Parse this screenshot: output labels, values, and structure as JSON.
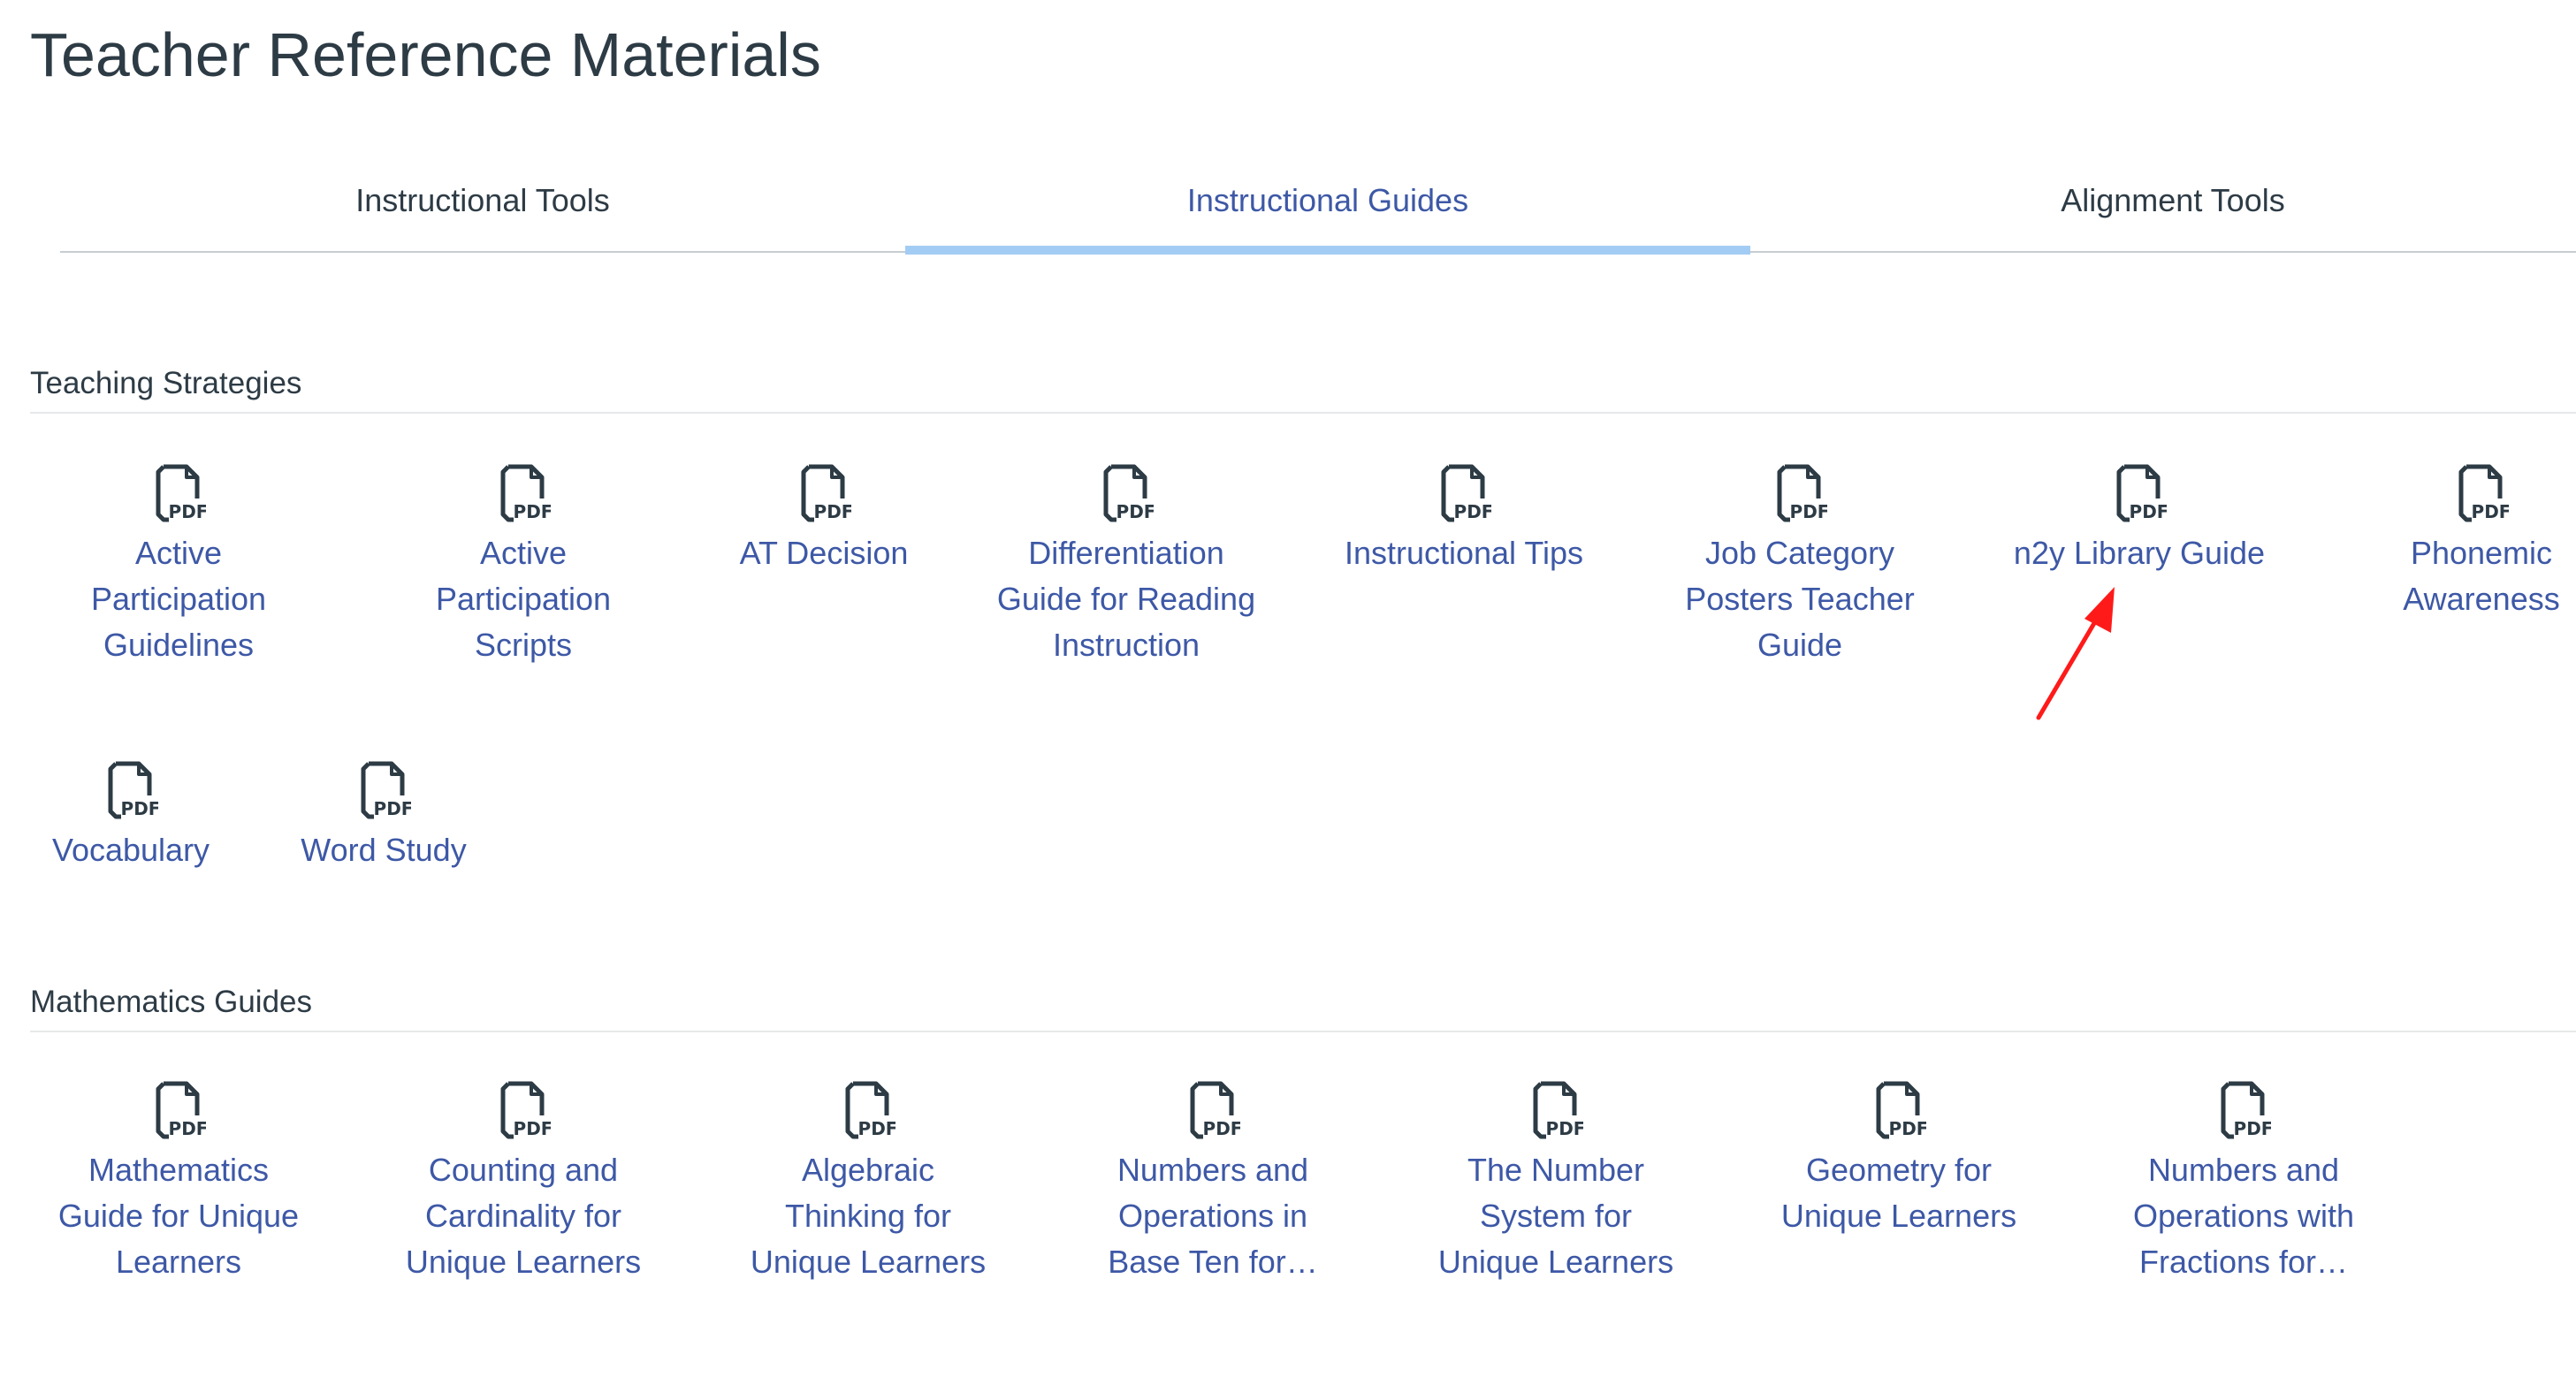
{
  "page": {
    "title": "Teacher Reference Materials"
  },
  "tabs": [
    {
      "label": "Instructional Tools",
      "active": false
    },
    {
      "label": "Instructional Guides",
      "active": true
    },
    {
      "label": "Alignment Tools",
      "active": false
    }
  ],
  "sections": [
    {
      "title": "Teaching Strategies",
      "items": [
        {
          "label": "Active Participation Guidelines",
          "icon": "pdf-file-icon"
        },
        {
          "label": "Active Participation Scripts",
          "icon": "pdf-file-icon"
        },
        {
          "label": "AT Decision",
          "icon": "pdf-file-icon"
        },
        {
          "label": "Differentiation Guide for Reading Instruction",
          "icon": "pdf-file-icon"
        },
        {
          "label": "Instructional Tips",
          "icon": "pdf-file-icon"
        },
        {
          "label": "Job Category Posters Teacher Guide",
          "icon": "pdf-file-icon"
        },
        {
          "label": "n2y Library Guide",
          "icon": "pdf-file-icon"
        },
        {
          "label": "Phonemic Awareness",
          "icon": "pdf-file-icon"
        },
        {
          "label": "Vocabulary",
          "icon": "pdf-file-icon"
        },
        {
          "label": "Word Study",
          "icon": "pdf-file-icon"
        }
      ]
    },
    {
      "title": "Mathematics Guides",
      "items": [
        {
          "label": "Mathematics Guide for Unique Learners",
          "icon": "pdf-file-icon"
        },
        {
          "label": "Counting and Cardinality for Unique Learners",
          "icon": "pdf-file-icon"
        },
        {
          "label": "Algebraic Thinking for Unique Learners",
          "icon": "pdf-file-icon"
        },
        {
          "label": "Numbers and Operations in Base Ten for…",
          "icon": "pdf-file-icon"
        },
        {
          "label": "The Number System for Unique Learners",
          "icon": "pdf-file-icon"
        },
        {
          "label": "Geometry for Unique Learners",
          "icon": "pdf-file-icon"
        },
        {
          "label": "Numbers and Operations with Fractions for…",
          "icon": "pdf-file-icon"
        }
      ]
    }
  ],
  "icon_text": "PDF",
  "colors": {
    "link": "#3d58a6",
    "text": "#2d3b45",
    "tab_active_bar": "#a3ccf4",
    "annotation_arrow": "#ff1a1a"
  }
}
